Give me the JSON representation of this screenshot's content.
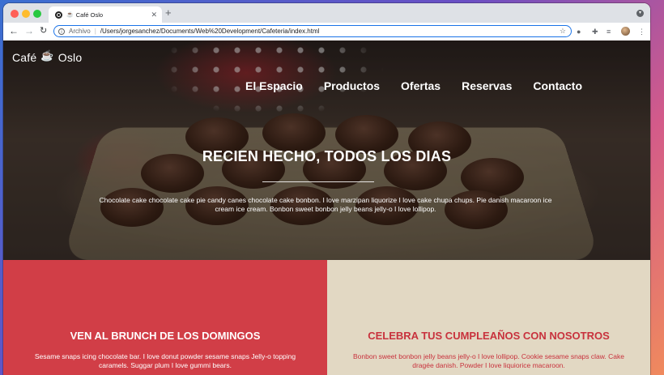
{
  "browser": {
    "tab_title": "Café Oslo",
    "new_tab_label": "+",
    "scheme_label": "Archivo",
    "url": "/Users/jorgesanchez/Documents/Web%20Development/Cafeteria/index.html"
  },
  "site": {
    "logo_left": "Café",
    "logo_right": "Oslo",
    "nav": [
      "El Espacio",
      "Productos",
      "Ofertas",
      "Reservas",
      "Contacto"
    ],
    "hero_title": "RECIEN HECHO, TODOS LOS DIAS",
    "hero_text": "Chocolate cake chocolate cake pie candy canes chocolate cake bonbon. I love marzipan liquorize I love cake chupa chups. Pie danish macaroon ice cream ice cream. Bonbon sweet bonbon jelly beans jelly-o I love lollipop.",
    "brunch_title": "VEN AL BRUNCH DE LOS DOMINGOS",
    "brunch_text": "Sesame snaps icing chocolate bar. I love donut powder sesame snaps Jelly-o topping caramels. Suggar plum I love gummi bears.",
    "birthday_title": "CELEBRA TUS CUMPLEAÑOS CON NOSOTROS",
    "birthday_text": "Bonbon sweet bonbon jelly beans jelly-o I love lollipop. Cookie sesame snaps claw. Cake dragée danish. Powder I love liquiorice macaroon."
  },
  "colors": {
    "brunch_bg": "#d13e47",
    "birthday_bg": "#e2d8c3",
    "birthday_text": "#c8323d",
    "omnibox_focus": "#1a73e8"
  }
}
